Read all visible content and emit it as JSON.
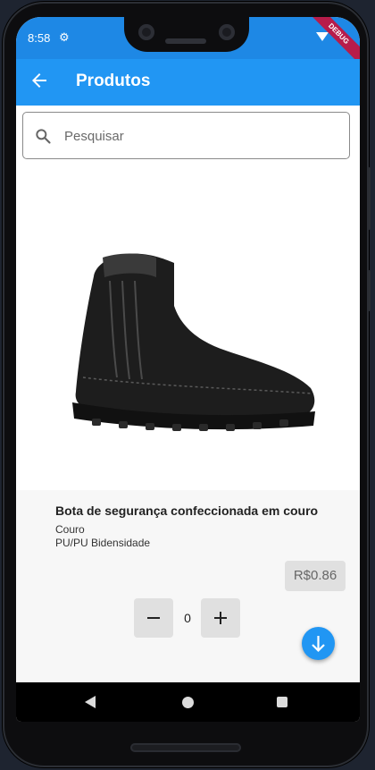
{
  "status": {
    "time": "8:58",
    "debug_label": "DEBUG"
  },
  "appbar": {
    "title": "Produtos"
  },
  "search": {
    "placeholder": "Pesquisar",
    "value": ""
  },
  "product": {
    "name": "Bota de segurança confeccionada em couro",
    "material": "Couro",
    "sole": "PU/PU Bidensidade",
    "price": "R$0.86",
    "quantity": "0"
  },
  "icons": {
    "back": "arrow-back-icon",
    "search": "search-icon",
    "minus": "minus-icon",
    "plus": "plus-icon",
    "fab": "arrow-down-icon",
    "settings": "gear-icon",
    "wifi": "wifi-icon"
  },
  "colors": {
    "primary": "#2196f3",
    "status_bar": "#1e88e5",
    "debug": "#b71c4a"
  }
}
